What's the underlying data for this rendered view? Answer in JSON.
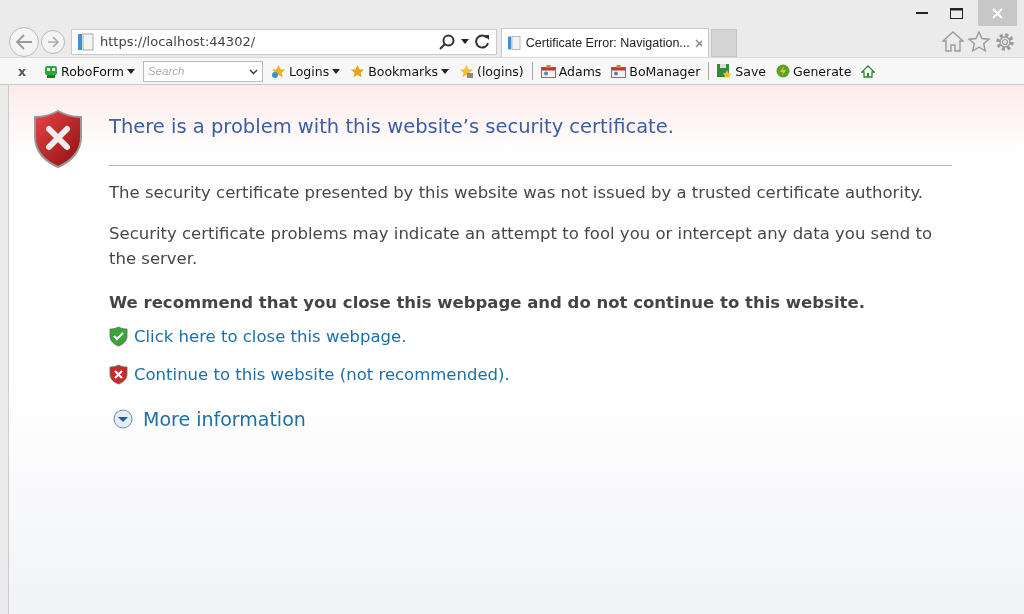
{
  "address_bar": {
    "url": "https://localhost:44302/"
  },
  "tabs": [
    {
      "title": "Certificate Error: Navigation...",
      "selected": true
    }
  ],
  "toolbar": [
    {
      "kind": "close",
      "label": "x"
    },
    {
      "kind": "robo",
      "label": "RoboForm",
      "dropdown": true
    },
    {
      "kind": "search",
      "placeholder": "Search"
    },
    {
      "kind": "logins",
      "label": "Logins",
      "dropdown": true
    },
    {
      "kind": "bookmarks",
      "label": "Bookmarks",
      "dropdown": true
    },
    {
      "kind": "loginset",
      "label": "(logins)",
      "dropdown": false
    },
    {
      "kind": "separator"
    },
    {
      "kind": "identity",
      "label": "Adams",
      "dropdown": false
    },
    {
      "kind": "identity",
      "label": "BoManager",
      "dropdown": false
    },
    {
      "kind": "separator"
    },
    {
      "kind": "save",
      "label": "Save",
      "dropdown": false
    },
    {
      "kind": "generate",
      "label": "Generate",
      "dropdown": false
    },
    {
      "kind": "home"
    }
  ],
  "page": {
    "heading": "There is a problem with this website’s security certificate.",
    "paragraphs": [
      "The security certificate presented by this website was not issued by a trusted certificate authority.",
      "Security certificate problems may indicate an attempt to fool you or intercept any data you send to the server."
    ],
    "recommendation": "We recommend that you close this webpage and do not continue to this website.",
    "links": [
      {
        "kind": "safe",
        "label": "Click here to close this webpage."
      },
      {
        "kind": "unsafe",
        "label": "Continue to this website (not recommended)."
      }
    ],
    "more_info": {
      "label": "More information",
      "expanded": false
    }
  }
}
